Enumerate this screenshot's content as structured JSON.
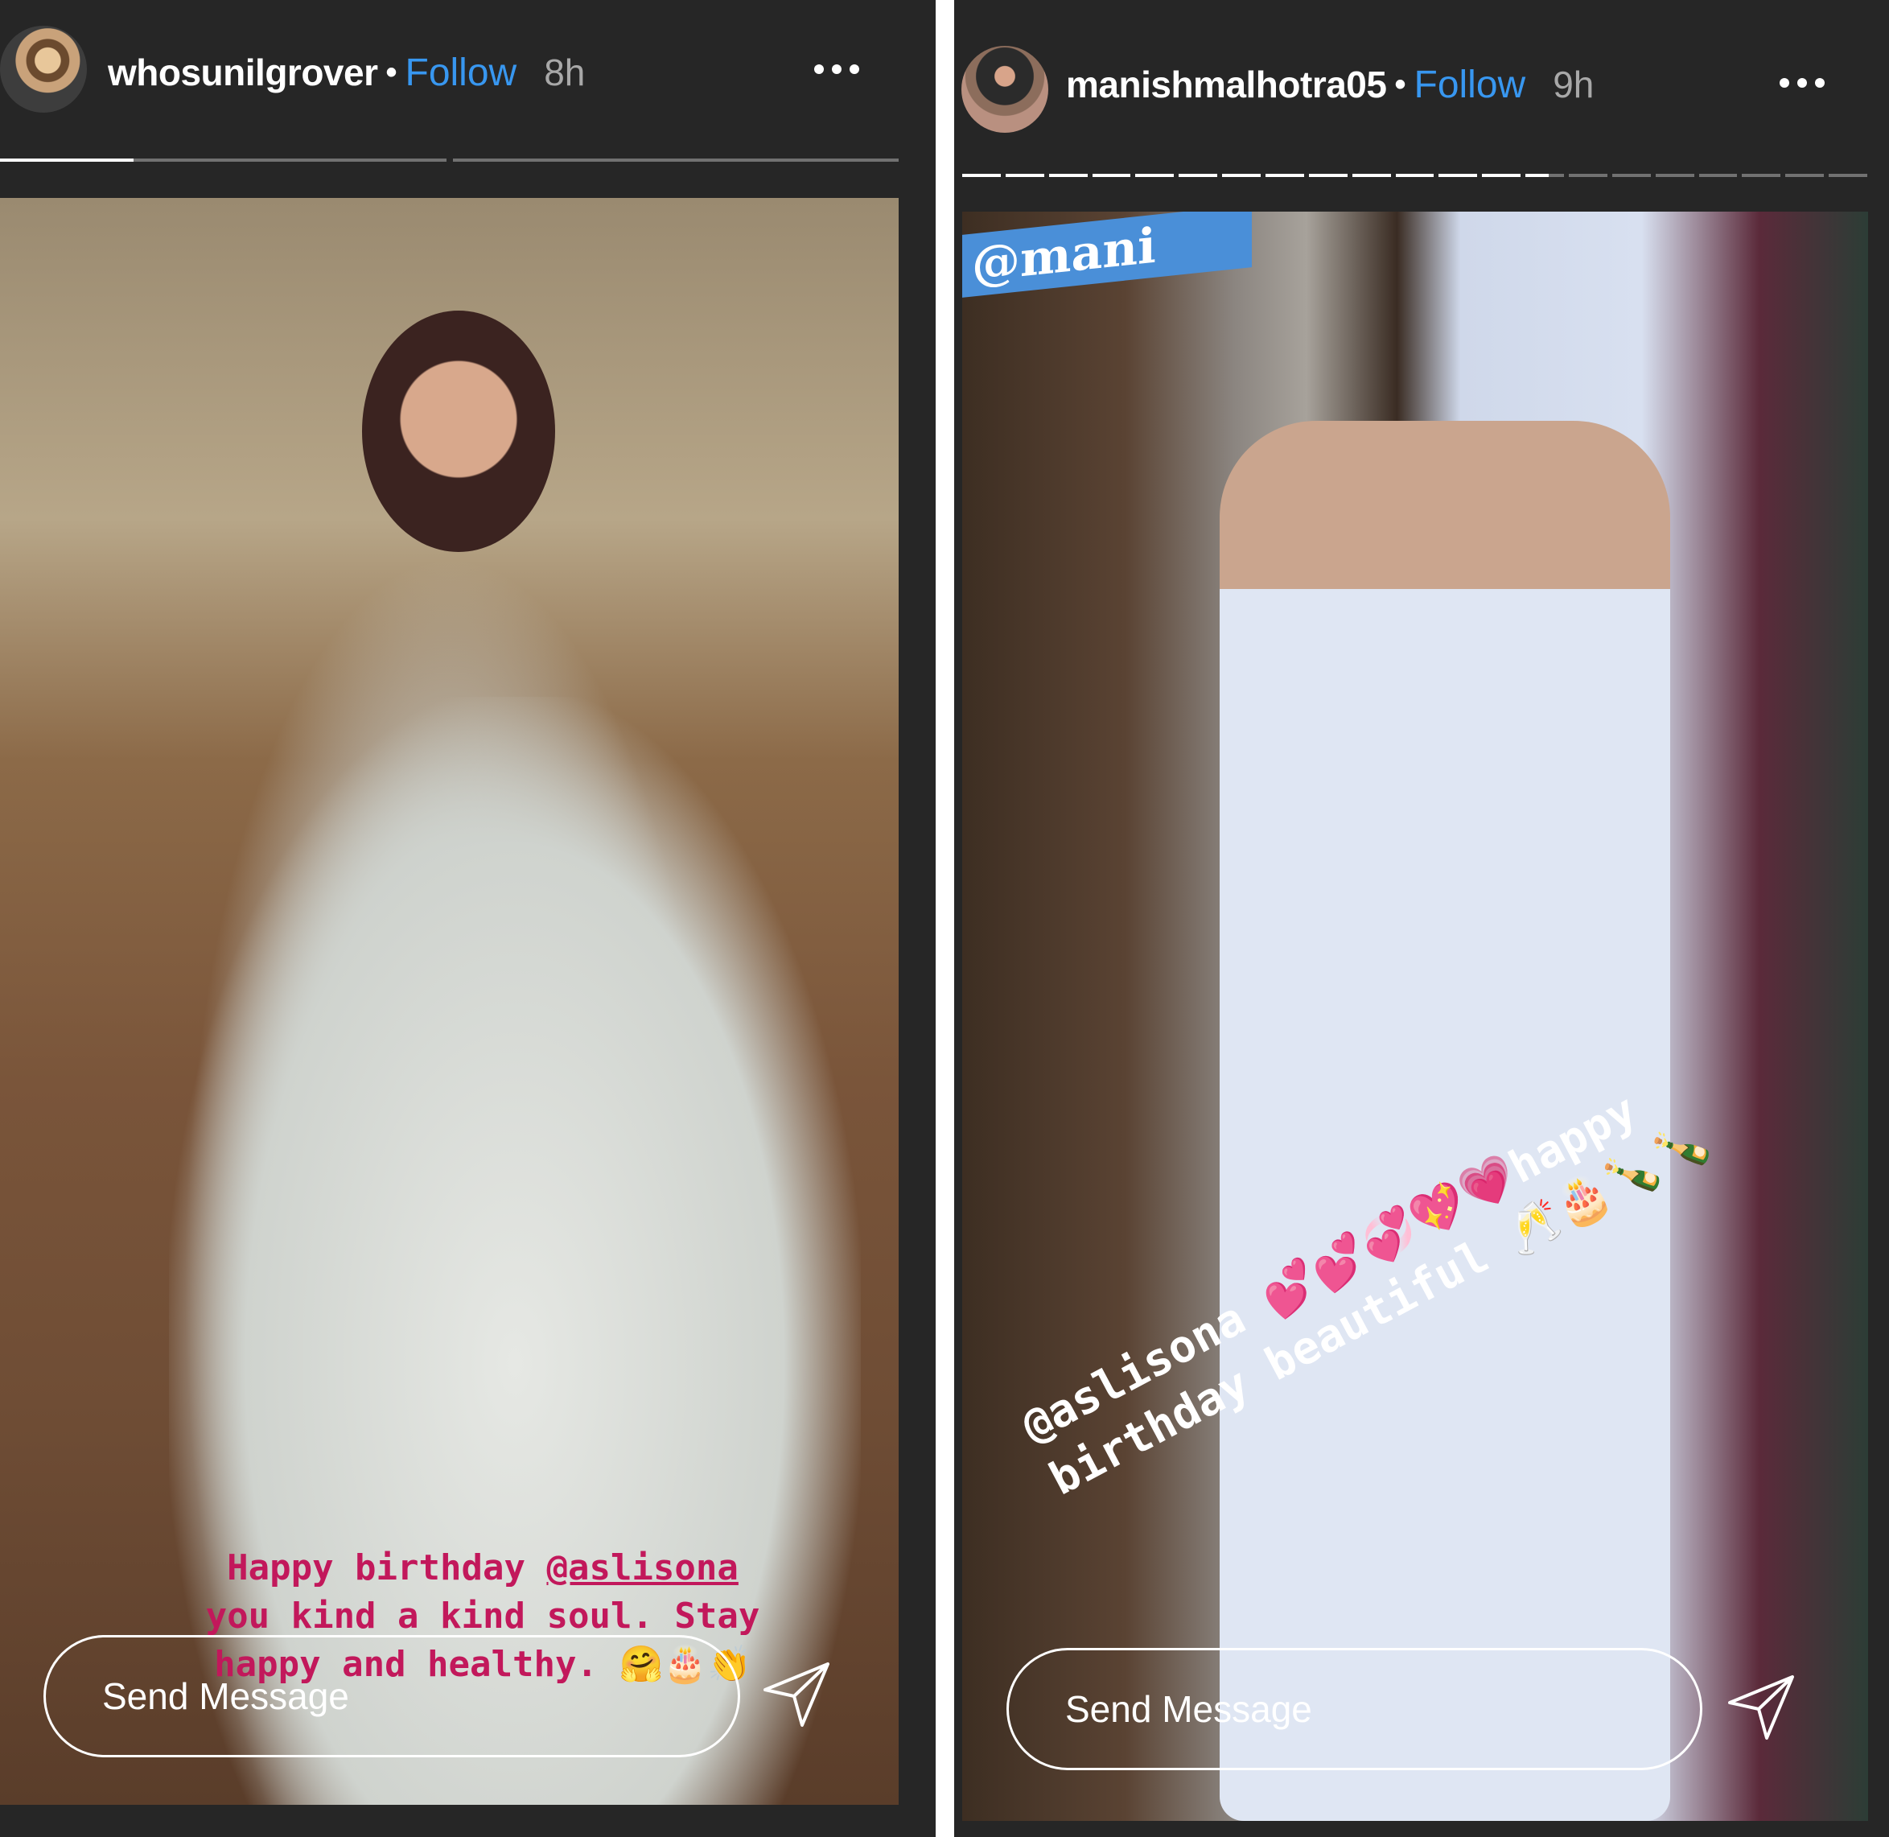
{
  "stories": {
    "left": {
      "username": "whosunilgrover",
      "separator": "•",
      "follow_label": "Follow",
      "time": "8h",
      "caption_line1_a": "Happy birthday ",
      "caption_mention": "@aslisona",
      "caption_line2": "you kind a kind soul. Stay",
      "caption_line3": "happy and healthy.",
      "caption_emoji": "🤗🎂👏",
      "send_placeholder": "Send Message"
    },
    "right": {
      "username": "manishmalhotra05",
      "separator": "•",
      "follow_label": "Follow",
      "time": "9h",
      "tag_sticker": "@mani",
      "caption_line1": "@aslisona 💕💕💞💖💗happy",
      "caption_line2": "birthday beautiful 🥂🎂🍾🍾",
      "send_placeholder": "Send Message"
    }
  },
  "colors": {
    "background": "#262626",
    "follow": "#3897f0",
    "caption_left": "#c2185b",
    "caption_right": "#ffffff"
  }
}
